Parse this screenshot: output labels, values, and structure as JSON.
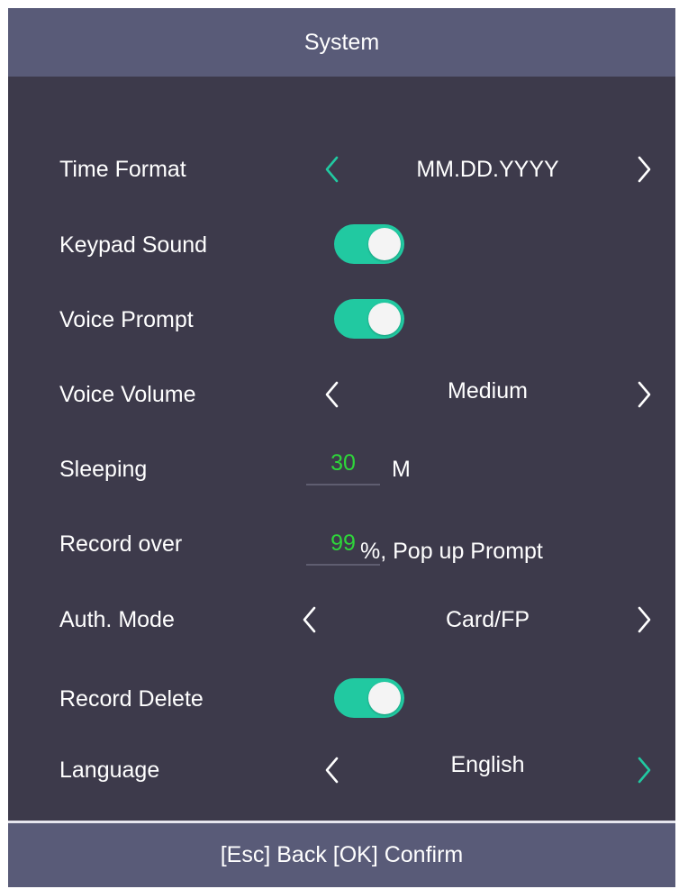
{
  "header": {
    "title": "System"
  },
  "colors": {
    "accent": "#21c9a1",
    "highlight_value": "#2ed63a",
    "bar": "#595b78",
    "background": "#3d3a4b"
  },
  "settings": {
    "time_format": {
      "label": "Time Format",
      "value": "MM.DD.YYYY",
      "left_icon": "chevron-left-icon",
      "right_icon": "chevron-right-icon",
      "left_active": true,
      "right_active": false
    },
    "keypad_sound": {
      "label": "Keypad Sound",
      "on": true
    },
    "voice_prompt": {
      "label": "Voice Prompt",
      "on": true
    },
    "voice_volume": {
      "label": "Voice Volume",
      "value": "Medium",
      "left_active": false,
      "right_active": false
    },
    "sleeping": {
      "label": "Sleeping",
      "value": "30",
      "unit": "M"
    },
    "record_over": {
      "label": "Record over",
      "value": "99",
      "suffix": "%, Pop up Prompt"
    },
    "auth_mode": {
      "label": "Auth. Mode",
      "value": "Card/FP",
      "left_active": false,
      "right_active": false
    },
    "record_delete": {
      "label": "Record Delete",
      "on": true
    },
    "language": {
      "label": "Language",
      "value": "English",
      "left_active": false,
      "right_active": true
    }
  },
  "footer": {
    "hint": "[Esc] Back [OK] Confirm"
  }
}
